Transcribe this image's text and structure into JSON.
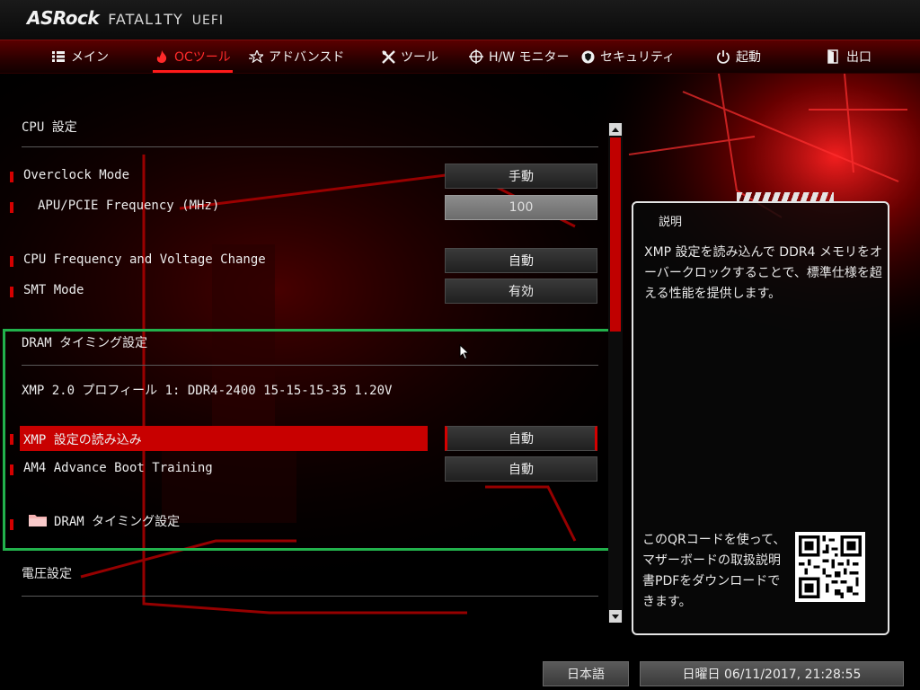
{
  "header": {
    "brand": "ASRock",
    "product_line": "FATAL1TY",
    "product_suffix": "UEFI"
  },
  "nav": {
    "tabs": [
      {
        "label": "メイン",
        "icon": "list-icon",
        "active": false
      },
      {
        "label": "OCツール",
        "icon": "flame-icon",
        "active": true
      },
      {
        "label": "アドバンスド",
        "icon": "star-icon",
        "active": false
      },
      {
        "label": "ツール",
        "icon": "tools-icon",
        "active": false
      },
      {
        "label": "H/W モニター",
        "icon": "crosshair-icon",
        "active": false
      },
      {
        "label": "セキュリティ",
        "icon": "shield-icon",
        "active": false
      },
      {
        "label": "起動",
        "icon": "power-icon",
        "active": false
      },
      {
        "label": "出口",
        "icon": "exit-door-icon",
        "active": false
      }
    ]
  },
  "main": {
    "cpu_section_title": "CPU 設定",
    "rows": {
      "overclock_mode": {
        "label": "Overclock Mode",
        "value": "手動"
      },
      "apu_pcie_freq": {
        "label": "APU/PCIE Frequency (MHz)",
        "value": "100"
      },
      "cpu_freq_voltage": {
        "label": "CPU Frequency and Voltage Change",
        "value": "自動"
      },
      "smt_mode": {
        "label": "SMT Mode",
        "value": "有効"
      },
      "load_xmp": {
        "label": "XMP 設定の読み込み",
        "value": "自動"
      },
      "am4_boot_training": {
        "label": "AM4 Advance Boot Training",
        "value": "自動"
      }
    },
    "dram_section_title": "DRAM タイミング設定",
    "xmp_profile_info": "XMP 2.0 プロフィール 1: DDR4-2400 15-15-15-35 1.20V",
    "dram_timing_submenu": "DRAM タイミング設定",
    "voltage_section_title": "電圧設定"
  },
  "help": {
    "title": "説明",
    "description": "XMP 設定を読み込んで DDR4 メモリをオーバークロックすることで、標準仕様を超える性能を提供します。",
    "qr_text": "このQRコードを使って、マザーボードの取扱説明書PDFをダウンロードできます。"
  },
  "footer": {
    "language": "日本語",
    "datetime": "日曜日 06/11/2017, 21:28:55"
  },
  "colors": {
    "accent": "#c80000",
    "active_tab": "#ff2a2a",
    "frame_highlight": "#22b14c"
  }
}
